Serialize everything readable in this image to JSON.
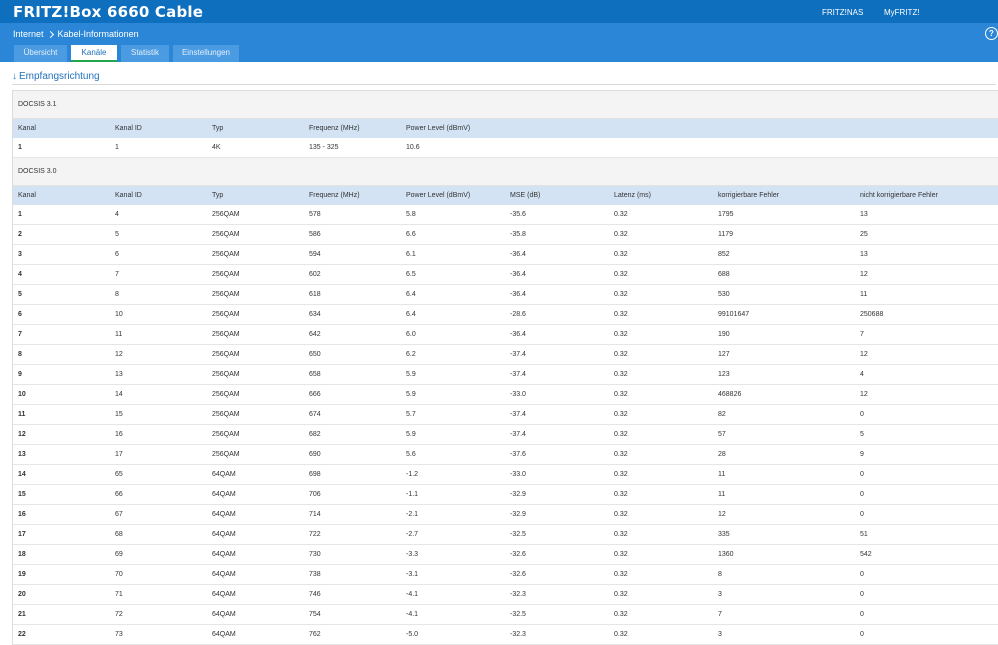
{
  "header": {
    "title": "FRITZ!Box 6660 Cable",
    "links": [
      "FRITZ!NAS",
      "MyFRITZ!"
    ]
  },
  "breadcrumb": [
    "Internet",
    "Kabel-Informationen"
  ],
  "help_label": "?",
  "tabs": [
    {
      "label": "Übersicht",
      "active": false
    },
    {
      "label": "Kanäle",
      "active": true
    },
    {
      "label": "Statistik",
      "active": false
    },
    {
      "label": "Einstellungen",
      "active": false
    }
  ],
  "section": {
    "arrow": "↓",
    "title": "Empfangsrichtung"
  },
  "docsis31": {
    "title": "DOCSIS 3.1",
    "headers": [
      "Kanal",
      "Kanal ID",
      "Typ",
      "Frequenz (MHz)",
      "Power Level (dBmV)"
    ],
    "rows": [
      [
        "1",
        "1",
        "4K",
        "135 - 325",
        "10.6"
      ]
    ]
  },
  "docsis30": {
    "title": "DOCSIS 3.0",
    "headers": [
      "Kanal",
      "Kanal ID",
      "Typ",
      "Frequenz (MHz)",
      "Power Level (dBmV)",
      "MSE (dB)",
      "Latenz (ms)",
      "korrigierbare Fehler",
      "nicht korrigierbare Fehler"
    ],
    "rows": [
      [
        "1",
        "4",
        "256QAM",
        "578",
        "5.8",
        "-35.6",
        "0.32",
        "1795",
        "13"
      ],
      [
        "2",
        "5",
        "256QAM",
        "586",
        "6.6",
        "-35.8",
        "0.32",
        "1179",
        "25"
      ],
      [
        "3",
        "6",
        "256QAM",
        "594",
        "6.1",
        "-36.4",
        "0.32",
        "852",
        "13"
      ],
      [
        "4",
        "7",
        "256QAM",
        "602",
        "6.5",
        "-36.4",
        "0.32",
        "688",
        "12"
      ],
      [
        "5",
        "8",
        "256QAM",
        "618",
        "6.4",
        "-36.4",
        "0.32",
        "530",
        "11"
      ],
      [
        "6",
        "10",
        "256QAM",
        "634",
        "6.4",
        "-28.6",
        "0.32",
        "99101647",
        "250688"
      ],
      [
        "7",
        "11",
        "256QAM",
        "642",
        "6.0",
        "-36.4",
        "0.32",
        "190",
        "7"
      ],
      [
        "8",
        "12",
        "256QAM",
        "650",
        "6.2",
        "-37.4",
        "0.32",
        "127",
        "12"
      ],
      [
        "9",
        "13",
        "256QAM",
        "658",
        "5.9",
        "-37.4",
        "0.32",
        "123",
        "4"
      ],
      [
        "10",
        "14",
        "256QAM",
        "666",
        "5.9",
        "-33.0",
        "0.32",
        "468826",
        "12"
      ],
      [
        "11",
        "15",
        "256QAM",
        "674",
        "5.7",
        "-37.4",
        "0.32",
        "82",
        "0"
      ],
      [
        "12",
        "16",
        "256QAM",
        "682",
        "5.9",
        "-37.4",
        "0.32",
        "57",
        "5"
      ],
      [
        "13",
        "17",
        "256QAM",
        "690",
        "5.6",
        "-37.6",
        "0.32",
        "28",
        "9"
      ],
      [
        "14",
        "65",
        "64QAM",
        "698",
        "-1.2",
        "-33.0",
        "0.32",
        "11",
        "0"
      ],
      [
        "15",
        "66",
        "64QAM",
        "706",
        "-1.1",
        "-32.9",
        "0.32",
        "11",
        "0"
      ],
      [
        "16",
        "67",
        "64QAM",
        "714",
        "-2.1",
        "-32.9",
        "0.32",
        "12",
        "0"
      ],
      [
        "17",
        "68",
        "64QAM",
        "722",
        "-2.7",
        "-32.5",
        "0.32",
        "335",
        "51"
      ],
      [
        "18",
        "69",
        "64QAM",
        "730",
        "-3.3",
        "-32.6",
        "0.32",
        "1360",
        "542"
      ],
      [
        "19",
        "70",
        "64QAM",
        "738",
        "-3.1",
        "-32.6",
        "0.32",
        "8",
        "0"
      ],
      [
        "20",
        "71",
        "64QAM",
        "746",
        "-4.1",
        "-32.3",
        "0.32",
        "3",
        "0"
      ],
      [
        "21",
        "72",
        "64QAM",
        "754",
        "-4.1",
        "-32.5",
        "0.32",
        "7",
        "0"
      ],
      [
        "22",
        "73",
        "64QAM",
        "762",
        "-5.0",
        "-32.3",
        "0.32",
        "3",
        "0"
      ]
    ]
  }
}
